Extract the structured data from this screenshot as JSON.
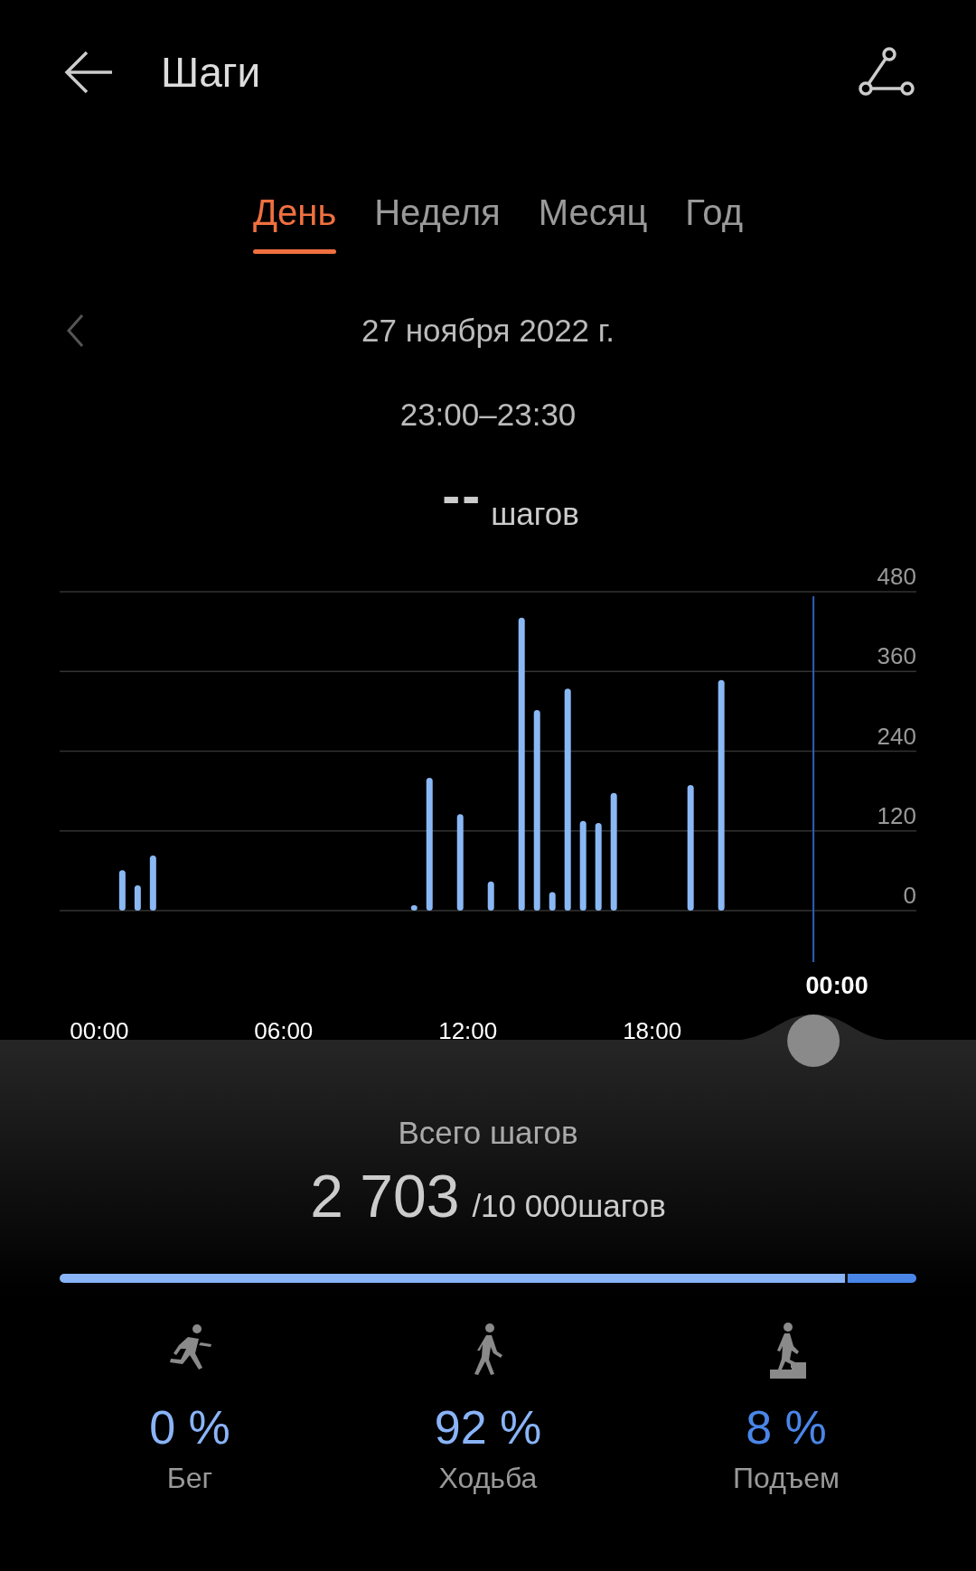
{
  "header": {
    "title": "Шаги"
  },
  "tabs": [
    {
      "label": "День",
      "selected": true
    },
    {
      "label": "Неделя",
      "selected": false
    },
    {
      "label": "Месяц",
      "selected": false
    },
    {
      "label": "Год",
      "selected": false
    }
  ],
  "date": "27 ноября 2022 г.",
  "time_range": "23:00–23:30",
  "selected_steps": {
    "value": "--",
    "unit": "шагов"
  },
  "chart": {
    "cursor_label": "00:00",
    "chart_data": {
      "type": "bar",
      "grid": true,
      "x": [
        0.75,
        1.25,
        1.75,
        10.25,
        10.75,
        11.75,
        12.75,
        13.75,
        14.25,
        14.75,
        15.25,
        15.75,
        16.25,
        16.75,
        19.25,
        20.25
      ],
      "values": [
        61,
        38,
        83,
        8,
        200,
        145,
        44,
        441,
        302,
        28,
        334,
        135,
        132,
        177,
        189,
        347
      ],
      "xlim": [
        -1.29,
        26.6
      ],
      "ylim": [
        0,
        480
      ],
      "xticks": [
        {
          "value": 0,
          "label": "00:00"
        },
        {
          "value": 6,
          "label": "06:00"
        },
        {
          "value": 12,
          "label": "12:00"
        },
        {
          "value": 18,
          "label": "18:00"
        }
      ],
      "yticks": [
        0,
        120,
        240,
        360,
        480
      ],
      "ref_lines": [
        {
          "axis": "x",
          "value": 23.25
        }
      ]
    }
  },
  "summary": {
    "label": "Всего шагов",
    "total": "2 703",
    "goal": "/10 000шагов"
  },
  "activities": [
    {
      "kind": "run",
      "percent": "0 %",
      "label": "Бег",
      "color": "#8ab4f8"
    },
    {
      "kind": "walk",
      "percent": "92 %",
      "label": "Ходьба",
      "color": "#8ab4f8",
      "level": 0.92
    },
    {
      "kind": "climb",
      "percent": "8 %",
      "label": "Подъем",
      "color": "#4a86e8",
      "level": 0.08
    }
  ]
}
